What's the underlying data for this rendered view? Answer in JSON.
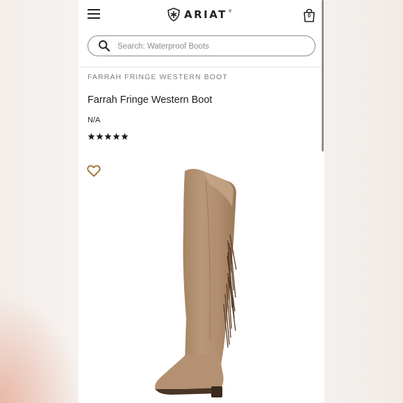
{
  "header": {
    "brand": "ARIAT",
    "trademark": "®",
    "cart_count": "0"
  },
  "search": {
    "placeholder": "Search: Waterproof Boots",
    "value": ""
  },
  "product": {
    "breadcrumb": "FARRAH FRINGE WESTERN BOOT",
    "title": "Farrah Fringe Western Boot",
    "price": "N/A",
    "rating_stars": 5
  },
  "icons": {
    "menu": "menu-icon",
    "logo_mark": "ariat-shield-icon",
    "cart": "shopping-bag-icon",
    "search": "search-icon",
    "star": "star-icon",
    "wishlist": "heart-icon"
  },
  "colors": {
    "text": "#1e1e1e",
    "breadcrumb": "#7d7d7d",
    "heart": "#a06a2e",
    "boot": "#b08e6c"
  }
}
